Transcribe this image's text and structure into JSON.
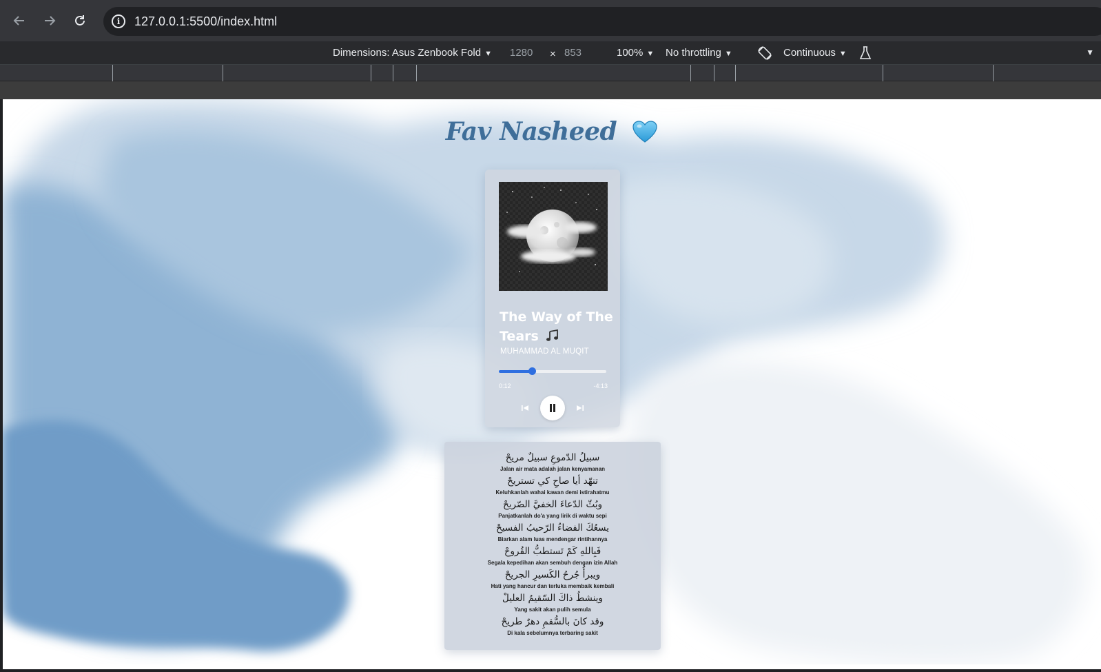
{
  "browser": {
    "url": "127.0.0.1:5500/index.html",
    "nav_icons": [
      "back-arrow-icon",
      "forward-arrow-icon",
      "reload-icon",
      "info-icon"
    ]
  },
  "device_toolbar": {
    "dimensions_label": "Dimensions: Asus Zenbook Fold",
    "width": "1280",
    "times": "×",
    "height": "853",
    "zoom": "100%",
    "throttling": "No throttling",
    "mode": "Continuous"
  },
  "page": {
    "title": "Fav Nasheed",
    "title_color": "#3f6e99",
    "accent": "#2f6fe0"
  },
  "player": {
    "song_title": "The Way of The Tears",
    "artist": "MUHAMMAD AL MUQIT",
    "current_time": "0:12",
    "remaining_time": "-4:13",
    "progress_fraction": 0.31,
    "icons": [
      "prev-track-icon",
      "pause-icon",
      "next-track-icon",
      "music-notes-icon"
    ]
  },
  "lyrics": [
    {
      "ar": "سبيلُ الدّموعِ سبيلٌ مريحْ",
      "id": "Jalan air mata adalah jalan kenyamanan"
    },
    {
      "ar": "تنهّد أيا صاحِ كي تستريحْ",
      "id": "Keluhkanlah wahai kawan demi istirahatmu"
    },
    {
      "ar": "وبُثّ الدّعاءَ الخفيَّ الصّريحْ",
      "id": "Panjatkanlah do'a yang lirik di waktu sepi"
    },
    {
      "ar": "يسعُكَ الفضاءُ الرّحيبُ الفسيحْ",
      "id": "Biarkan alam luas mendengar rintihannya"
    },
    {
      "ar": "فَبِاللهِ كَمْ تَستطبُّ القُروحْ",
      "id": "Segala kepedihan akan sembuh dengan izin Allah"
    },
    {
      "ar": "ويبرأُ جُرحُ الكَسيرِ الجريحْ",
      "id": "Hati yang hancur dan terluka membaik kembali"
    },
    {
      "ar": "وينشطُ ذاكَ السّقيمُ العليلْ",
      "id": "Yang sakit akan pulih semula"
    },
    {
      "ar": "وقد كانَ بالسُّقمِ دهرٌ طريحْ",
      "id": "Di kala sebelumnya terbaring sakit"
    }
  ]
}
